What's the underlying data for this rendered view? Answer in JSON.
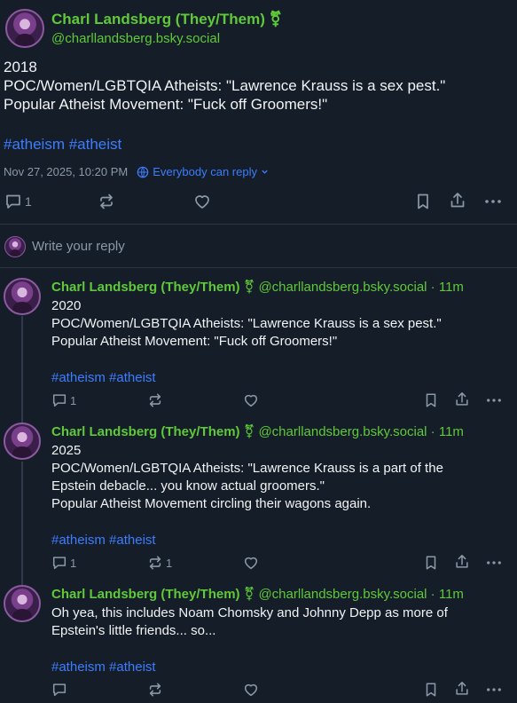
{
  "main_post": {
    "author_name": "Charl Landsberg (They/Them)",
    "author_symbol": "⚧",
    "handle": "@charllandsberg.bsky.social",
    "body_lines": [
      "2018",
      "POC/Women/LGBTQIA Atheists: \"Lawrence Krauss is a sex pest.\"",
      "Popular Atheist Movement: \"Fuck off Groomers!\""
    ],
    "tags": "#atheism #atheist",
    "timestamp": "Nov 27, 2025, 10:20 PM",
    "reply_setting": "Everybody can reply",
    "reply_count": "1"
  },
  "reply_box": {
    "placeholder": "Write your reply"
  },
  "replies": [
    {
      "author_name": "Charl Landsberg (They/Them)",
      "author_symbol": "⚧",
      "handle": "@charllandsberg.bsky.social",
      "age": "· 11m",
      "body_lines": [
        "2020",
        "POC/Women/LGBTQIA Atheists: \"Lawrence Krauss is a sex pest.\"",
        "Popular Atheist Movement: \"Fuck off Groomers!\""
      ],
      "tags": "#atheism #atheist",
      "reply_count": "1",
      "repost_count": ""
    },
    {
      "author_name": "Charl Landsberg (They/Them)",
      "author_symbol": "⚧",
      "handle": "@charllandsberg.bsky.social",
      "age": "· 11m",
      "body_lines": [
        "2025",
        "POC/Women/LGBTQIA Atheists: \"Lawrence Krauss is a part of the",
        "Epstein debacle... you know actual groomers.\"",
        "Popular Atheist Movement circling their wagons again."
      ],
      "tags": "#atheism #atheist",
      "reply_count": "1",
      "repost_count": "1"
    },
    {
      "author_name": "Charl Landsberg (They/Them)",
      "author_symbol": "⚧",
      "handle": "@charllandsberg.bsky.social",
      "age": "· 11m",
      "body_lines": [
        "Oh yea, this includes Noam Chomsky and Johnny Depp as more of",
        "Epstein's little friends... so..."
      ],
      "tags": "#atheism #atheist",
      "reply_count": "",
      "repost_count": ""
    }
  ],
  "colors": {
    "background": "#151d28",
    "author_green": "#5fc93a",
    "link_blue": "#3d7dff",
    "muted": "#8b98a8"
  }
}
